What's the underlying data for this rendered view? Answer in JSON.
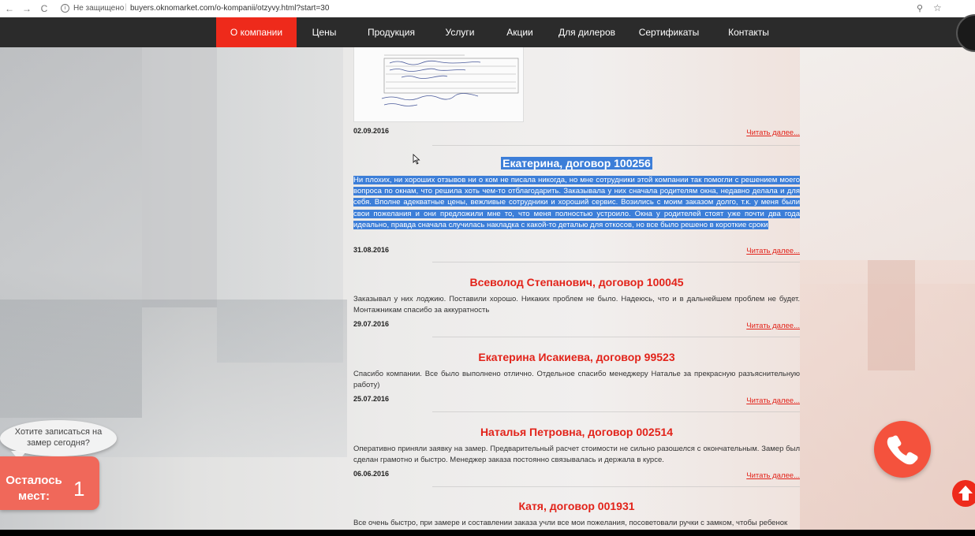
{
  "browser": {
    "back_glyph": "←",
    "forward_glyph": "→",
    "reload_glyph": "C",
    "security_text": "Не защищено",
    "url": "buyers.oknomarket.com/o-kompanii/otzyvy.html?start=30",
    "zoom_icon": "magnifier-icon",
    "star_icon": "star-icon"
  },
  "nav": {
    "items": [
      {
        "label": "О компании",
        "active": true
      },
      {
        "label": "Цены"
      },
      {
        "label": "Продукция"
      },
      {
        "label": "Услуги"
      },
      {
        "label": "Акции"
      },
      {
        "label": "Для дилеров"
      },
      {
        "label": "Сертификаты"
      },
      {
        "label": "Контакты"
      }
    ],
    "active_color": "#ee2a1b",
    "bar_color": "#2b2b2b"
  },
  "reviews": [
    {
      "title": "",
      "text": "",
      "date": "02.09.2016",
      "read_more": "Читать далее..."
    },
    {
      "title": "Екатерина, договор 100256",
      "text": "Ни плохих, ни хороших отзывов ни о ком не писала никогда, но мне сотрудники этой компании так помогли с решением моего вопроса по окнам, что решила хоть чем-то  отблагодарить. Заказывала у них сначала родителям окна, недавно делала и для себя. Вполне адекватные цены, вежливые сотрудники и хороший сервис. Возились с моим заказом долго, т.к. у меня были свои пожелания и они предложили мне то, что меня полностью устроило. Окна у родителей стоят уже почти два года идеально, правда сначала случилась накладка с какой-то деталью для откосов, но все было решено в короткие сроки",
      "date": "31.08.2016",
      "read_more": "Читать далее..."
    },
    {
      "title": "Всеволод Степанович, договор 100045",
      "text": "Заказывал у них лоджию. Поставили хорошо. Никаких проблем не было. Надеюсь, что и в дальнейшем проблем не будет. Монтажникам спасибо за аккуратность",
      "date": "29.07.2016",
      "read_more": "Читать далее..."
    },
    {
      "title": "Екатерина Исакиева, договор 99523",
      "text": "Спасибо компании. Все было выполнено отлично. Отдельное спасибо менеджеру Наталье за прекрасную разъяснительную работу)",
      "date": "25.07.2016",
      "read_more": "Читать далее..."
    },
    {
      "title": "Наталья Петровна, договор 002514",
      "text": "Оперативно приняли заявку на замер. Предварительный расчет стоимости не сильно разошелся с окончательным. Замер был сделан грамотно и быстро. Менеджер заказа постоянно связывалась и держала в курсе.",
      "date": "06.06.2016",
      "read_more": "Читать далее..."
    },
    {
      "title": "Катя, договор 001931",
      "text": "Все очень быстро, при замере и составлении заказа учли все мои пожелания, посоветовали ручки с замком, чтобы ребенок",
      "date": "",
      "read_more": ""
    }
  ],
  "widget": {
    "bubble_text": "Хотите записаться на замер сегодня?",
    "seats_label": "Осталось мест:",
    "seats_count": "1"
  },
  "floating": {
    "call_icon": "phone-icon",
    "up_icon": "arrow-up-icon"
  },
  "colors": {
    "accent": "#e2231a",
    "selection": "#3c7ed8",
    "call_button": "#f4523d",
    "seats_box": "#f0685a"
  }
}
